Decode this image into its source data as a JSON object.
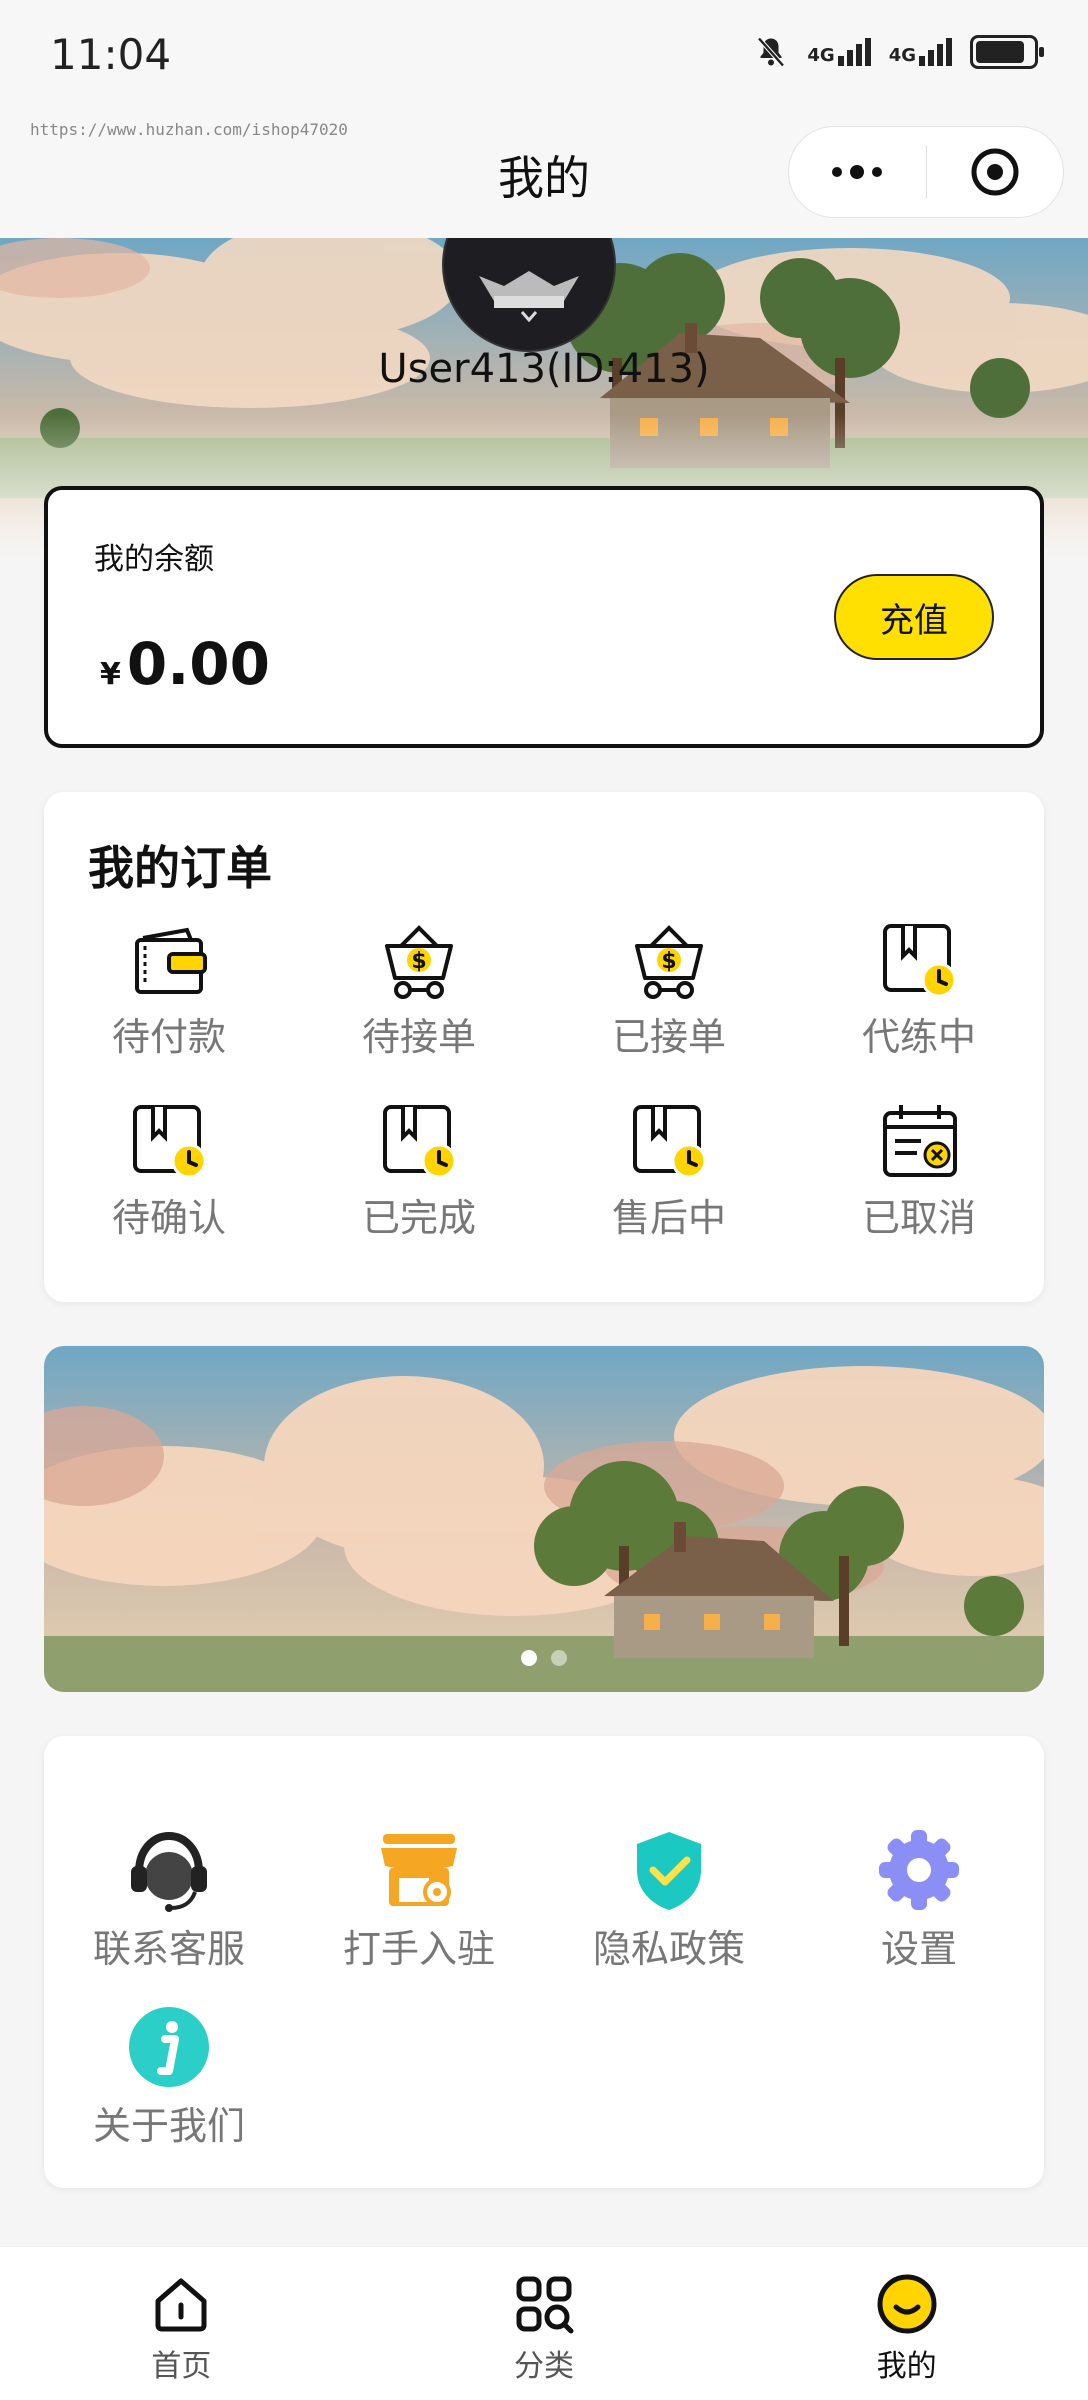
{
  "status_bar": {
    "time": "11:04",
    "network_1": "4G",
    "network_2": "4G"
  },
  "nav": {
    "watermark": "https://www.huzhan.com/ishop47020",
    "title": "我的"
  },
  "user": {
    "name": "User413(ID:413)"
  },
  "balance": {
    "label": "我的余额",
    "currency": "¥",
    "amount": "0.00",
    "recharge_label": "充值"
  },
  "orders": {
    "title": "我的订单",
    "items": [
      {
        "label": "待付款",
        "icon": "wallet-icon"
      },
      {
        "label": "待接单",
        "icon": "basket-dollar-icon"
      },
      {
        "label": "已接单",
        "icon": "basket-dollar-icon"
      },
      {
        "label": "代练中",
        "icon": "box-clock-icon"
      },
      {
        "label": "待确认",
        "icon": "box-clock-icon"
      },
      {
        "label": "已完成",
        "icon": "box-clock-icon"
      },
      {
        "label": "售后中",
        "icon": "box-clock-icon"
      },
      {
        "label": "已取消",
        "icon": "calendar-cancel-icon"
      }
    ]
  },
  "banner": {
    "slide_count": 2,
    "active_slide": 1
  },
  "services": {
    "items": [
      {
        "label": "联系客服",
        "icon": "headset-icon",
        "color": "#222222"
      },
      {
        "label": "打手入驻",
        "icon": "store-icon",
        "color": "#f5a623"
      },
      {
        "label": "隐私政策",
        "icon": "shield-check-icon",
        "color": "#1cc8c2"
      },
      {
        "label": "设置",
        "icon": "gear-icon",
        "color": "#8b8ef5"
      },
      {
        "label": "关于我们",
        "icon": "info-icon",
        "color": "#2ccfc8"
      }
    ]
  },
  "tabbar": {
    "items": [
      {
        "label": "首页",
        "icon": "home-icon"
      },
      {
        "label": "分类",
        "icon": "category-icon"
      },
      {
        "label": "我的",
        "icon": "smile-icon",
        "active": true
      }
    ]
  },
  "colors": {
    "accent": "#ffe000",
    "text": "#111111",
    "muted": "#777777"
  }
}
